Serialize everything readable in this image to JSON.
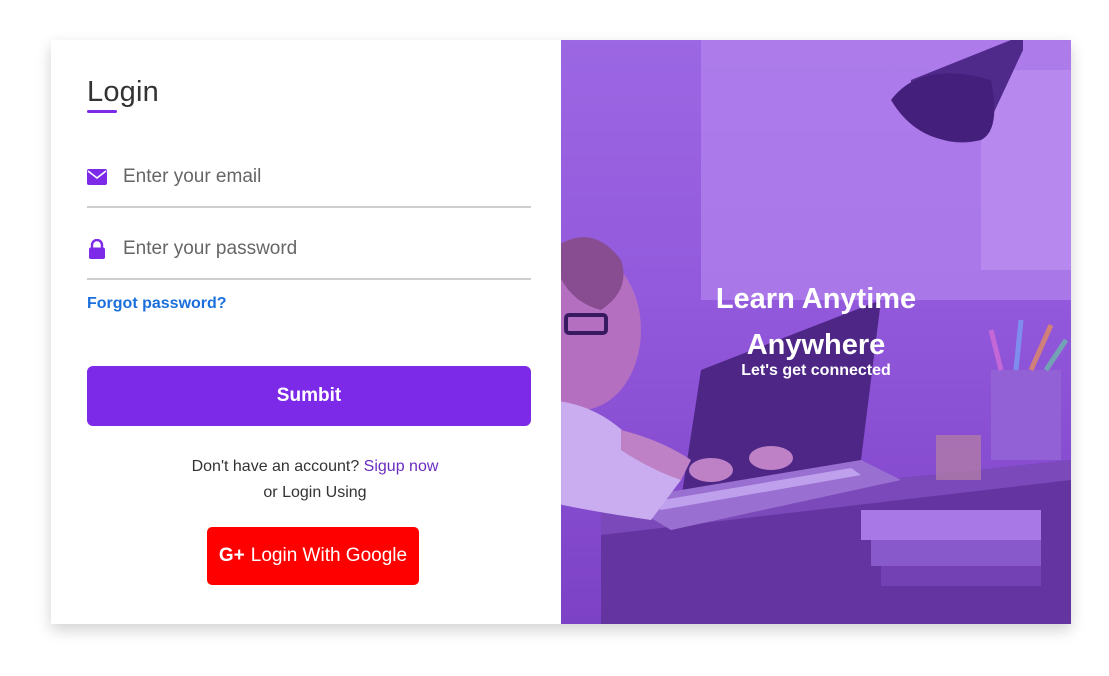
{
  "login": {
    "title": "Login",
    "email_placeholder": "Enter your email",
    "password_placeholder": "Enter your password",
    "forgot_label": "Forgot password?",
    "submit_label": "Sumbit",
    "signup_prompt": "Don't have an account?",
    "signup_link": "Sigup now",
    "or_label": "or Login Using",
    "google_label": "Login With Google",
    "google_icon": "G+"
  },
  "hero": {
    "line1": "Learn Anytime",
    "line2": "Anywhere",
    "subtitle": "Let's get connected"
  },
  "colors": {
    "accent": "#7d2ae8",
    "google": "#ff0000",
    "link": "#1a6fdc"
  },
  "icons": {
    "email": "envelope-icon",
    "password": "lock-icon"
  }
}
